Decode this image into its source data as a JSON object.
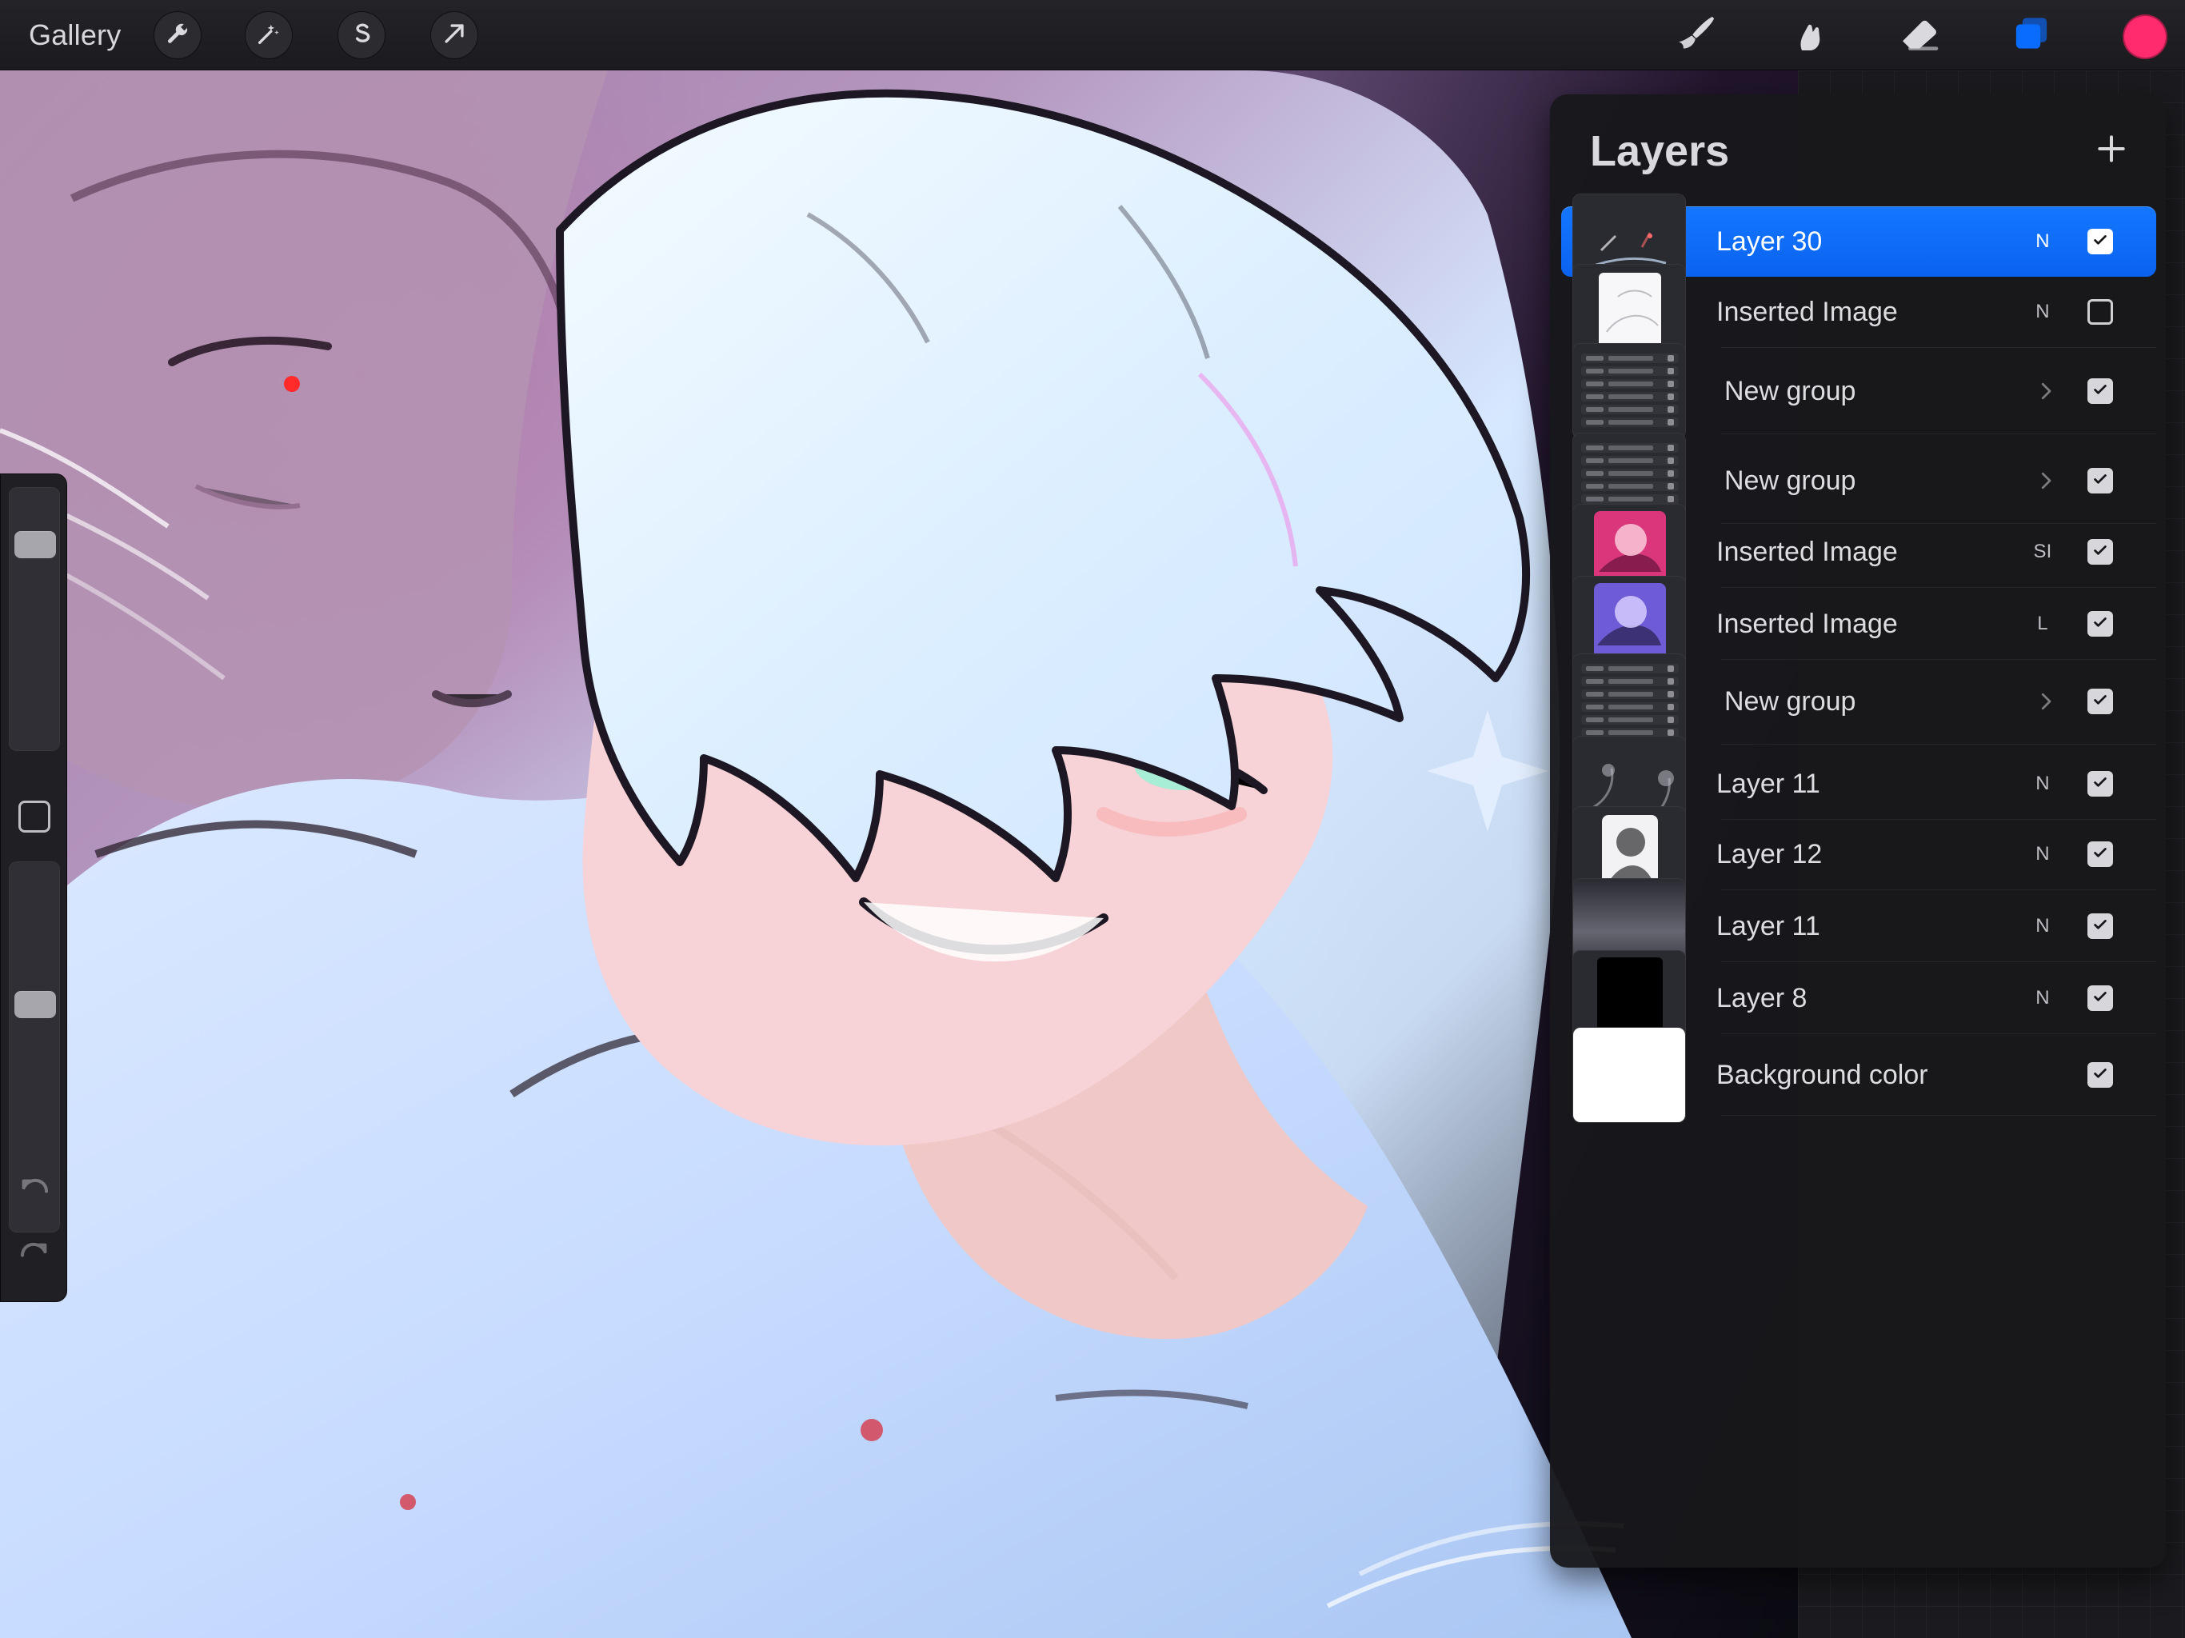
{
  "app": {
    "top_bar": {
      "gallery_label": "Gallery",
      "left_tools": [
        {
          "name": "actions",
          "icon": "wrench-icon"
        },
        {
          "name": "adjustments",
          "icon": "magic-wand-icon"
        },
        {
          "name": "selection",
          "icon": "selection-s-icon"
        },
        {
          "name": "transform",
          "icon": "arrow-cursor-icon"
        }
      ],
      "right_tools": [
        {
          "name": "brush",
          "icon": "brush-icon"
        },
        {
          "name": "smudge",
          "icon": "smudge-icon"
        },
        {
          "name": "eraser",
          "icon": "eraser-icon"
        },
        {
          "name": "layers",
          "icon": "layers-icon"
        }
      ],
      "current_color": "#ff2b6e"
    },
    "sidebar": {
      "brush_size_level": 0.83,
      "opacity_level": 0.63,
      "undo_icon": "undo-icon",
      "redo_icon": "redo-icon"
    },
    "layers_panel": {
      "title": "Layers",
      "add_icon": "plus-icon",
      "items": [
        {
          "name": "Layer 30",
          "blend": "N",
          "checked": true,
          "selected": true,
          "type": "layer",
          "thumb": "dark-sketch"
        },
        {
          "name": "Inserted Image",
          "blend": "N",
          "checked": false,
          "selected": false,
          "type": "layer",
          "thumb": "white-sketch"
        },
        {
          "name": "New group",
          "blend": "",
          "checked": true,
          "selected": false,
          "type": "group",
          "thumb": "group-list-1"
        },
        {
          "name": "New group",
          "blend": "",
          "checked": true,
          "selected": false,
          "type": "group",
          "thumb": "group-list-2"
        },
        {
          "name": "Inserted Image",
          "blend": "SI",
          "checked": true,
          "selected": false,
          "type": "layer",
          "thumb": "magenta-art"
        },
        {
          "name": "Inserted Image",
          "blend": "L",
          "checked": true,
          "selected": false,
          "type": "layer",
          "thumb": "purple-art"
        },
        {
          "name": "New group",
          "blend": "",
          "checked": true,
          "selected": false,
          "type": "group",
          "thumb": "group-list-3"
        },
        {
          "name": "Layer 11",
          "blend": "N",
          "checked": true,
          "selected": false,
          "type": "layer",
          "thumb": "flowers"
        },
        {
          "name": "Layer 12",
          "blend": "N",
          "checked": true,
          "selected": false,
          "type": "layer",
          "thumb": "character-white"
        },
        {
          "name": "Layer 11",
          "blend": "N",
          "checked": true,
          "selected": false,
          "type": "layer",
          "thumb": "gray-gradient"
        },
        {
          "name": "Layer 8",
          "blend": "N",
          "checked": true,
          "selected": false,
          "type": "layer",
          "thumb": "black"
        },
        {
          "name": "Background color",
          "blend": "",
          "checked": true,
          "selected": false,
          "type": "background",
          "thumb": "white"
        }
      ]
    }
  }
}
